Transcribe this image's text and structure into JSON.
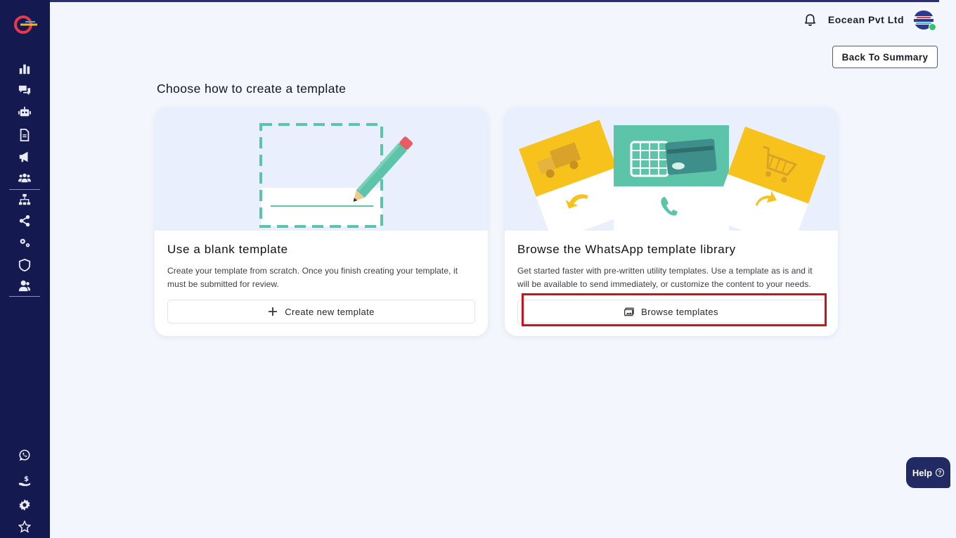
{
  "header": {
    "company": "Eocean Pvt Ltd",
    "back_label": "Back To Summary"
  },
  "page": {
    "title": "Choose how to create a template"
  },
  "cards": [
    {
      "title": "Use a blank template",
      "description": "Create your template from scratch. Once you finish creating your template, it must be submitted for review.",
      "cta": "Create new template"
    },
    {
      "title": "Browse the WhatsApp template library",
      "description": "Get started faster with pre-written utility templates. Use a template as is and it will be available to send immediately, or customize the content to your needs.",
      "cta": "Browse templates"
    }
  ],
  "help": {
    "label": "Help"
  },
  "sidebar": {
    "icons": [
      "dashboard-icon",
      "chat-icon",
      "bot-icon",
      "document-icon",
      "megaphone-icon",
      "users-icon",
      "sitemap-icon",
      "share-icon",
      "settings-cogs-icon",
      "shield-icon",
      "contacts-icon",
      "whatsapp-icon",
      "billing-icon",
      "gear-icon",
      "star-icon"
    ]
  },
  "colors": {
    "sidebar": "#141a4f",
    "accent_teal": "#5cc4a8",
    "accent_yellow": "#f7c21c",
    "highlight": "#c8121c",
    "help_bg": "#212a62"
  }
}
